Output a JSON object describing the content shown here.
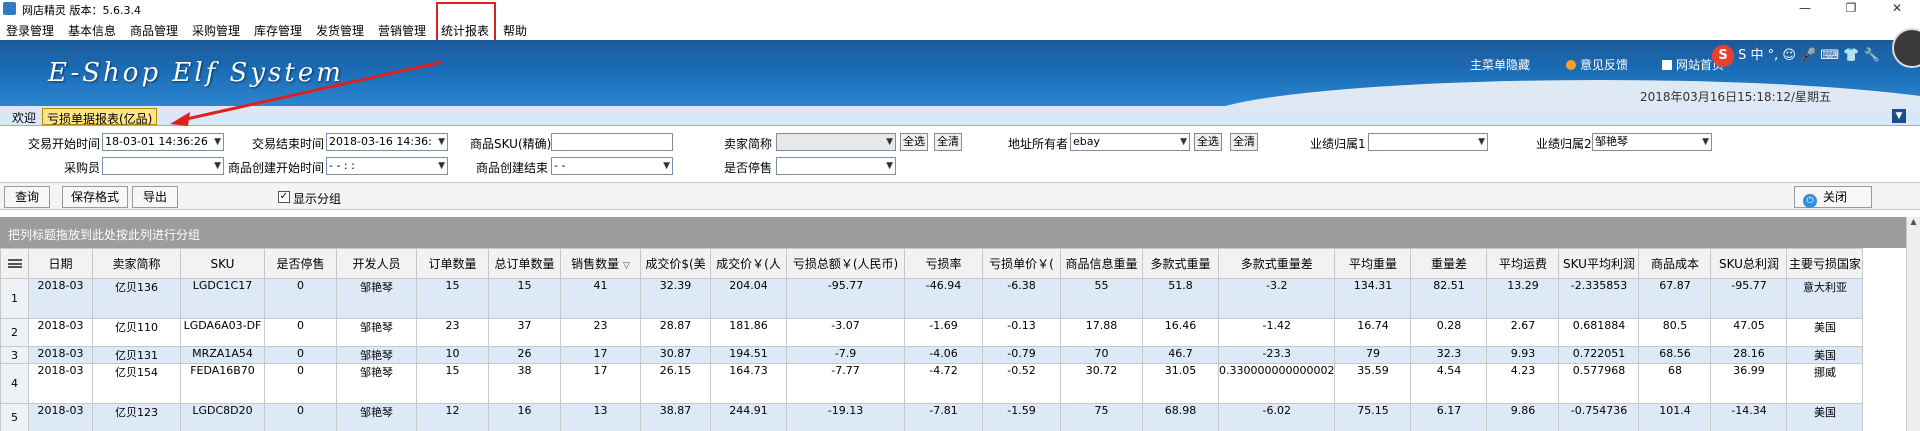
{
  "window": {
    "title": "网店精灵  版本：5.6.3.4",
    "minimize_glyph": "—",
    "maximize_glyph": "❐",
    "close_glyph": "✕"
  },
  "menu": [
    "登录管理",
    "基本信息",
    "商品管理",
    "采购管理",
    "库存管理",
    "发货管理",
    "营销管理",
    "统计报表",
    "帮助"
  ],
  "banner": {
    "logo": "E-Shop Elf System",
    "links": [
      "主菜单隐藏",
      "意见反馈",
      "网站首页"
    ],
    "datetime": "2018年03月16日15:18:12/星期五",
    "ime": "S 中 °, ☺ 🎤 ⌨ 👕 🔧"
  },
  "tabs": [
    "欢迎",
    "亏损单据报表(亿品)"
  ],
  "filters": {
    "trade_start_label": "交易开始时间",
    "trade_start_value": "18-03-01 14:36:26",
    "trade_end_label": "交易结束时间",
    "trade_end_value": "2018-03-16 14:36:",
    "sku_label": "商品SKU(精确)",
    "sku_value": "",
    "seller_label": "卖家简称",
    "seller_value": "",
    "select_all": "全选",
    "clear_all": "全清",
    "address_owner_label": "地址所有者",
    "address_owner_value": "ebay",
    "perf1_label": "业绩归属1",
    "perf1_value": "",
    "perf2_label": "业绩归属2",
    "perf2_value": "邹艳琴",
    "buyer_label": "采购员",
    "buyer_value": "",
    "created_start_label": "商品创建开始时间",
    "created_start_value": "- - : :",
    "created_end_label": "商品创建结束",
    "created_end_value": "- -",
    "discontinued_label": "是否停售",
    "discontinued_value": ""
  },
  "toolbar": {
    "query": "查询",
    "save_format": "保存格式",
    "export": "导出",
    "show_group": "显示分组",
    "close": "关闭"
  },
  "grid": {
    "group_hint": "把列标题拖放到此处按此列进行分组",
    "columns": [
      "日期",
      "卖家简称",
      "SKU",
      "是否停售",
      "开发人员",
      "订单数量",
      "总订单数量",
      "销售数量",
      "成交价$(美",
      "成交价￥(人",
      "亏损总额￥(人民币)",
      "亏损率",
      "亏损单价￥(",
      "商品信息重量",
      "多款式重量",
      "多款式重量差",
      "平均重量",
      "重量差",
      "平均运费",
      "SKU平均利润",
      "商品成本",
      "SKU总利润",
      "主要亏损国家"
    ],
    "rows": [
      [
        "1",
        "2018-03",
        "亿贝136",
        "LGDC1C17",
        "0",
        "邹艳琴",
        "15",
        "15",
        "41",
        "32.39",
        "204.04",
        "-95.77",
        "-46.94",
        "-6.38",
        "55",
        "51.8",
        "-3.2",
        "134.31",
        "82.51",
        "13.29",
        "-2.335853",
        "67.87",
        "-95.77",
        "意大利亚"
      ],
      [
        "2",
        "2018-03",
        "亿贝110",
        "LGDA6A03-DF",
        "0",
        "邹艳琴",
        "23",
        "37",
        "23",
        "28.87",
        "181.86",
        "-3.07",
        "-1.69",
        "-0.13",
        "17.88",
        "16.46",
        "-1.42",
        "16.74",
        "0.28",
        "2.67",
        "0.681884",
        "80.5",
        "47.05",
        "美国"
      ],
      [
        "3",
        "2018-03",
        "亿贝131",
        "MRZA1A54",
        "0",
        "邹艳琴",
        "10",
        "26",
        "17",
        "30.87",
        "194.51",
        "-7.9",
        "-4.06",
        "-0.79",
        "70",
        "46.7",
        "-23.3",
        "79",
        "32.3",
        "9.93",
        "0.722051",
        "68.56",
        "28.16",
        "美国"
      ],
      [
        "4",
        "2018-03",
        "亿贝154",
        "FEDA16B70",
        "0",
        "邹艳琴",
        "15",
        "38",
        "17",
        "26.15",
        "164.73",
        "-7.77",
        "-4.72",
        "-0.52",
        "30.72",
        "31.05",
        "0.330000000000002",
        "35.59",
        "4.54",
        "4.23",
        "0.577968",
        "68",
        "36.99",
        "挪威"
      ],
      [
        "5",
        "2018-03",
        "亿贝123",
        "LGDC8D20",
        "0",
        "邹艳琴",
        "12",
        "16",
        "13",
        "38.87",
        "244.91",
        "-19.13",
        "-7.81",
        "-1.59",
        "75",
        "68.98",
        "-6.02",
        "75.15",
        "6.17",
        "9.86",
        "-0.754736",
        "101.4",
        "-14.34",
        "美国"
      ]
    ]
  }
}
